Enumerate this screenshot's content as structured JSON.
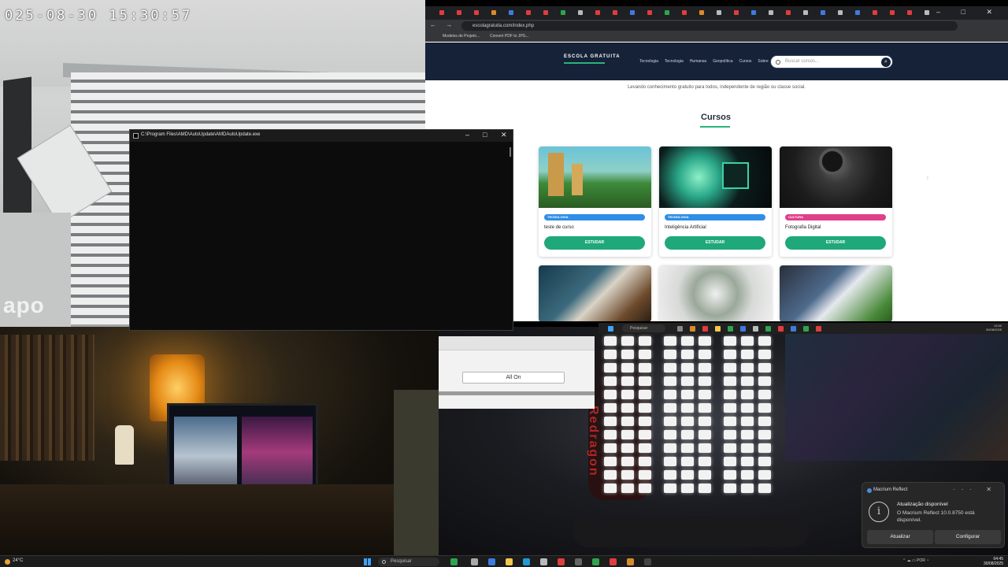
{
  "camera_top_left": {
    "timestamp": "025-08-30 15:30:57",
    "watermark": "apo"
  },
  "console_window": {
    "title": "C:\\Program Files\\AMD\\AutoUpdate\\AMDAutoUpdate.exe",
    "controls": {
      "minimize": "–",
      "maximize": "□",
      "close": "✕"
    }
  },
  "browser": {
    "url": "escolagratuita.com/index.php",
    "nav_buttons": "←  →  ⟳",
    "bookmarks": [
      "Modelos de Projeto...",
      "Convert PDF to JPG..."
    ],
    "window_controls": "–  □  ✕",
    "site": {
      "logo": "ESCOLA GRATUITA",
      "menu": [
        "Tecnologia",
        "Tecnologia",
        "Humanas",
        "Geopolítica",
        "Cursos",
        "Sobre"
      ],
      "search_placeholder": "Buscar cursos...",
      "search_button": "⌕",
      "tagline": "Levando conhecimento gratuito para todos, independente de região ou classe social.",
      "section_title": "Cursos",
      "cursor_glyph": "⁝",
      "courses": [
        {
          "category": "TECNOLOGIA",
          "title": "teste de curso",
          "button": "ESTUDAR",
          "badge_color": "#2f8ee6"
        },
        {
          "category": "TECNOLOGIA",
          "title": "Inteligência Artificial",
          "button": "ESTUDAR",
          "badge_color": "#2f8ee6"
        },
        {
          "category": "CULTURA",
          "title": "Fotografia Digital",
          "button": "ESTUDAR",
          "badge_color": "#e0408a"
        }
      ]
    }
  },
  "inset_window": {
    "button": "All On"
  },
  "chair_label": "Redragon",
  "toast": {
    "app": "Macrium Reflect",
    "controls": "···  ✕",
    "info_glyph": "i",
    "title": "Atualização disponível",
    "body": "O Macrium Reflect 10.0.8750 está disponível.",
    "actions": [
      "Atualizar",
      "Configurar"
    ]
  },
  "taskbar_mini": {
    "search": "Pesquisar",
    "time": "13:30",
    "date": "30/08/2025"
  },
  "taskbar": {
    "weather": "24°C",
    "search": "Pesquisar",
    "tray": "⌃  ☁  ▭  POR  ◔",
    "time": "04:45",
    "date": "30/08/2025"
  },
  "colors": {
    "site_header": "#152238",
    "accent_green": "#1fa97a",
    "console_bg": "#0c0c0c"
  }
}
